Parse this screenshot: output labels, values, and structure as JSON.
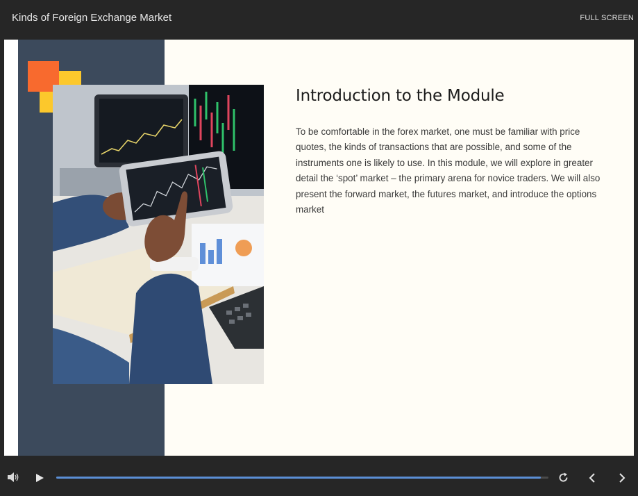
{
  "header": {
    "title": "Kinds of Foreign Exchange Market",
    "fullscreen_label": "FULL SCREEN"
  },
  "slide": {
    "heading": "Introduction to the Module",
    "body": "To be comfortable in the forex market, one must be familiar with price quotes, the kinds of transactions that are possible, and some of the instruments one is likely to use. In this module, we will explore in greater detail the ‘spot’ market – the primary arena for novice traders. We will also present the forward market, the futures market, and introduce the options market",
    "photo_icon": "tablet-stock-chart-photo",
    "colors": {
      "panel": "#3c4a5c",
      "accent_orange": "#f86a2e",
      "accent_yellow": "#fcc82c",
      "background": "#fffdf6"
    }
  },
  "player": {
    "progress_fraction": 0.985,
    "progress_color": "#5b8fd6",
    "icons": {
      "volume": "volume-icon",
      "play": "play-icon",
      "replay": "replay-icon",
      "prev": "chevron-left-icon",
      "next": "chevron-right-icon"
    }
  }
}
